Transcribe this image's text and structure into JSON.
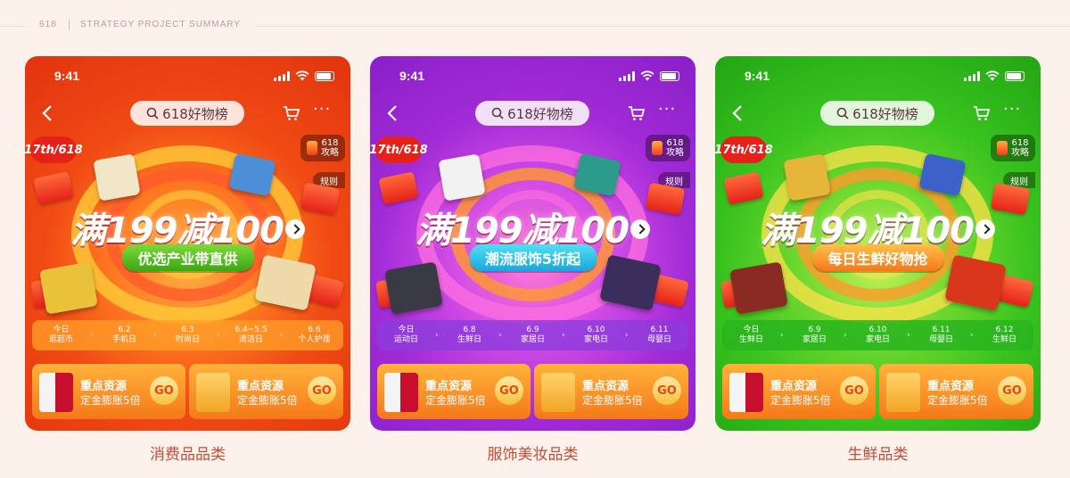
{
  "header": {
    "num": "618",
    "section": "STRATEGY PROJECT SUMMARY"
  },
  "cards": [
    {
      "time": "9:41",
      "search": "618好物榜",
      "badge": "17th/618",
      "guide": "618\n攻略",
      "guide_l1": "618",
      "guide_l2": "攻略",
      "rules": "规则",
      "headline": "满199减100",
      "sub": "优选产业带直供",
      "dates": [
        {
          "d": "今日",
          "n": "逛超市"
        },
        {
          "d": "6.2",
          "n": "手机日"
        },
        {
          "d": "6.3",
          "n": "时尚日"
        },
        {
          "d": "6.4~5.5",
          "n": "清洁日"
        },
        {
          "d": "6.6",
          "n": "个人护理"
        }
      ],
      "res_title": "重点资源",
      "res_sub": "定金膨胀5倍",
      "go": "GO",
      "caption": "消费品品类",
      "colors": {
        "bg": "#ef3a16",
        "accent": "#ffb000"
      }
    },
    {
      "time": "9:41",
      "search": "618好物榜",
      "badge": "17th/618",
      "guide_l1": "618",
      "guide_l2": "攻略",
      "rules": "规则",
      "headline": "满199减100",
      "sub": "潮流服饰5折起",
      "dates": [
        {
          "d": "今日",
          "n": "运动日"
        },
        {
          "d": "6.8",
          "n": "生鲜日"
        },
        {
          "d": "6.9",
          "n": "家居日"
        },
        {
          "d": "6.10",
          "n": "家电日"
        },
        {
          "d": "6.11",
          "n": "母婴日"
        }
      ],
      "res_title": "重点资源",
      "res_sub": "定金膨胀5倍",
      "go": "GO",
      "caption": "服饰美妆品类",
      "colors": {
        "bg": "#a12bd6",
        "accent": "#ffb000"
      }
    },
    {
      "time": "9:41",
      "search": "618好物榜",
      "badge": "17th/618",
      "guide_l1": "618",
      "guide_l2": "攻略",
      "rules": "规则",
      "headline": "满199减100",
      "sub": "每日生鲜好物抢",
      "dates": [
        {
          "d": "今日",
          "n": "生鲜日"
        },
        {
          "d": "6.9",
          "n": "家居日"
        },
        {
          "d": "6.10",
          "n": "家电日"
        },
        {
          "d": "6.11",
          "n": "母婴日"
        },
        {
          "d": "6.12",
          "n": "生鲜日"
        }
      ],
      "res_title": "重点资源",
      "res_sub": "定金膨胀5倍",
      "go": "GO",
      "caption": "生鲜品类",
      "colors": {
        "bg": "#2cb81e",
        "accent": "#ffb000"
      }
    }
  ]
}
